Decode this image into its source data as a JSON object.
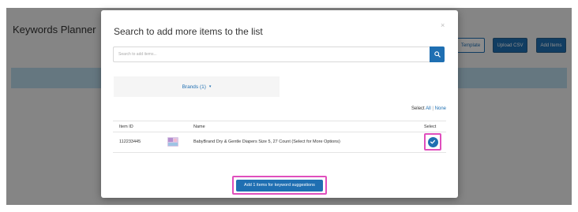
{
  "page": {
    "title": "Keywords Planner",
    "buttons": {
      "template_label": "Template",
      "upload_csv_label": "Upload CSV",
      "add_items_label": "Add Items"
    }
  },
  "modal": {
    "title": "Search to add more items to the list",
    "close_label": "×",
    "search": {
      "placeholder": "Search to add items...",
      "value": ""
    },
    "filter": {
      "label": "Brands (1)",
      "caret": "▾"
    },
    "select_controls": {
      "prefix": "Select",
      "all_label": "All",
      "separator": "|",
      "none_label": "None"
    },
    "table": {
      "headers": [
        "Item ID",
        "Name",
        "Select"
      ],
      "rows": [
        {
          "item_id": "112233445",
          "name": "BabyBrand Dry & Gentle Diapers Size 5, 27 Count (Select for More Options)",
          "selected": true
        }
      ]
    },
    "add_button_label": "Add 1 items for keyword suggestions"
  },
  "colors": {
    "primary": "#1f6fb2",
    "highlight": "#e04fbd",
    "band": "#b9d9e9"
  },
  "icons": {
    "search": "search-icon",
    "check": "check-icon",
    "product": "product-thumbnail"
  }
}
